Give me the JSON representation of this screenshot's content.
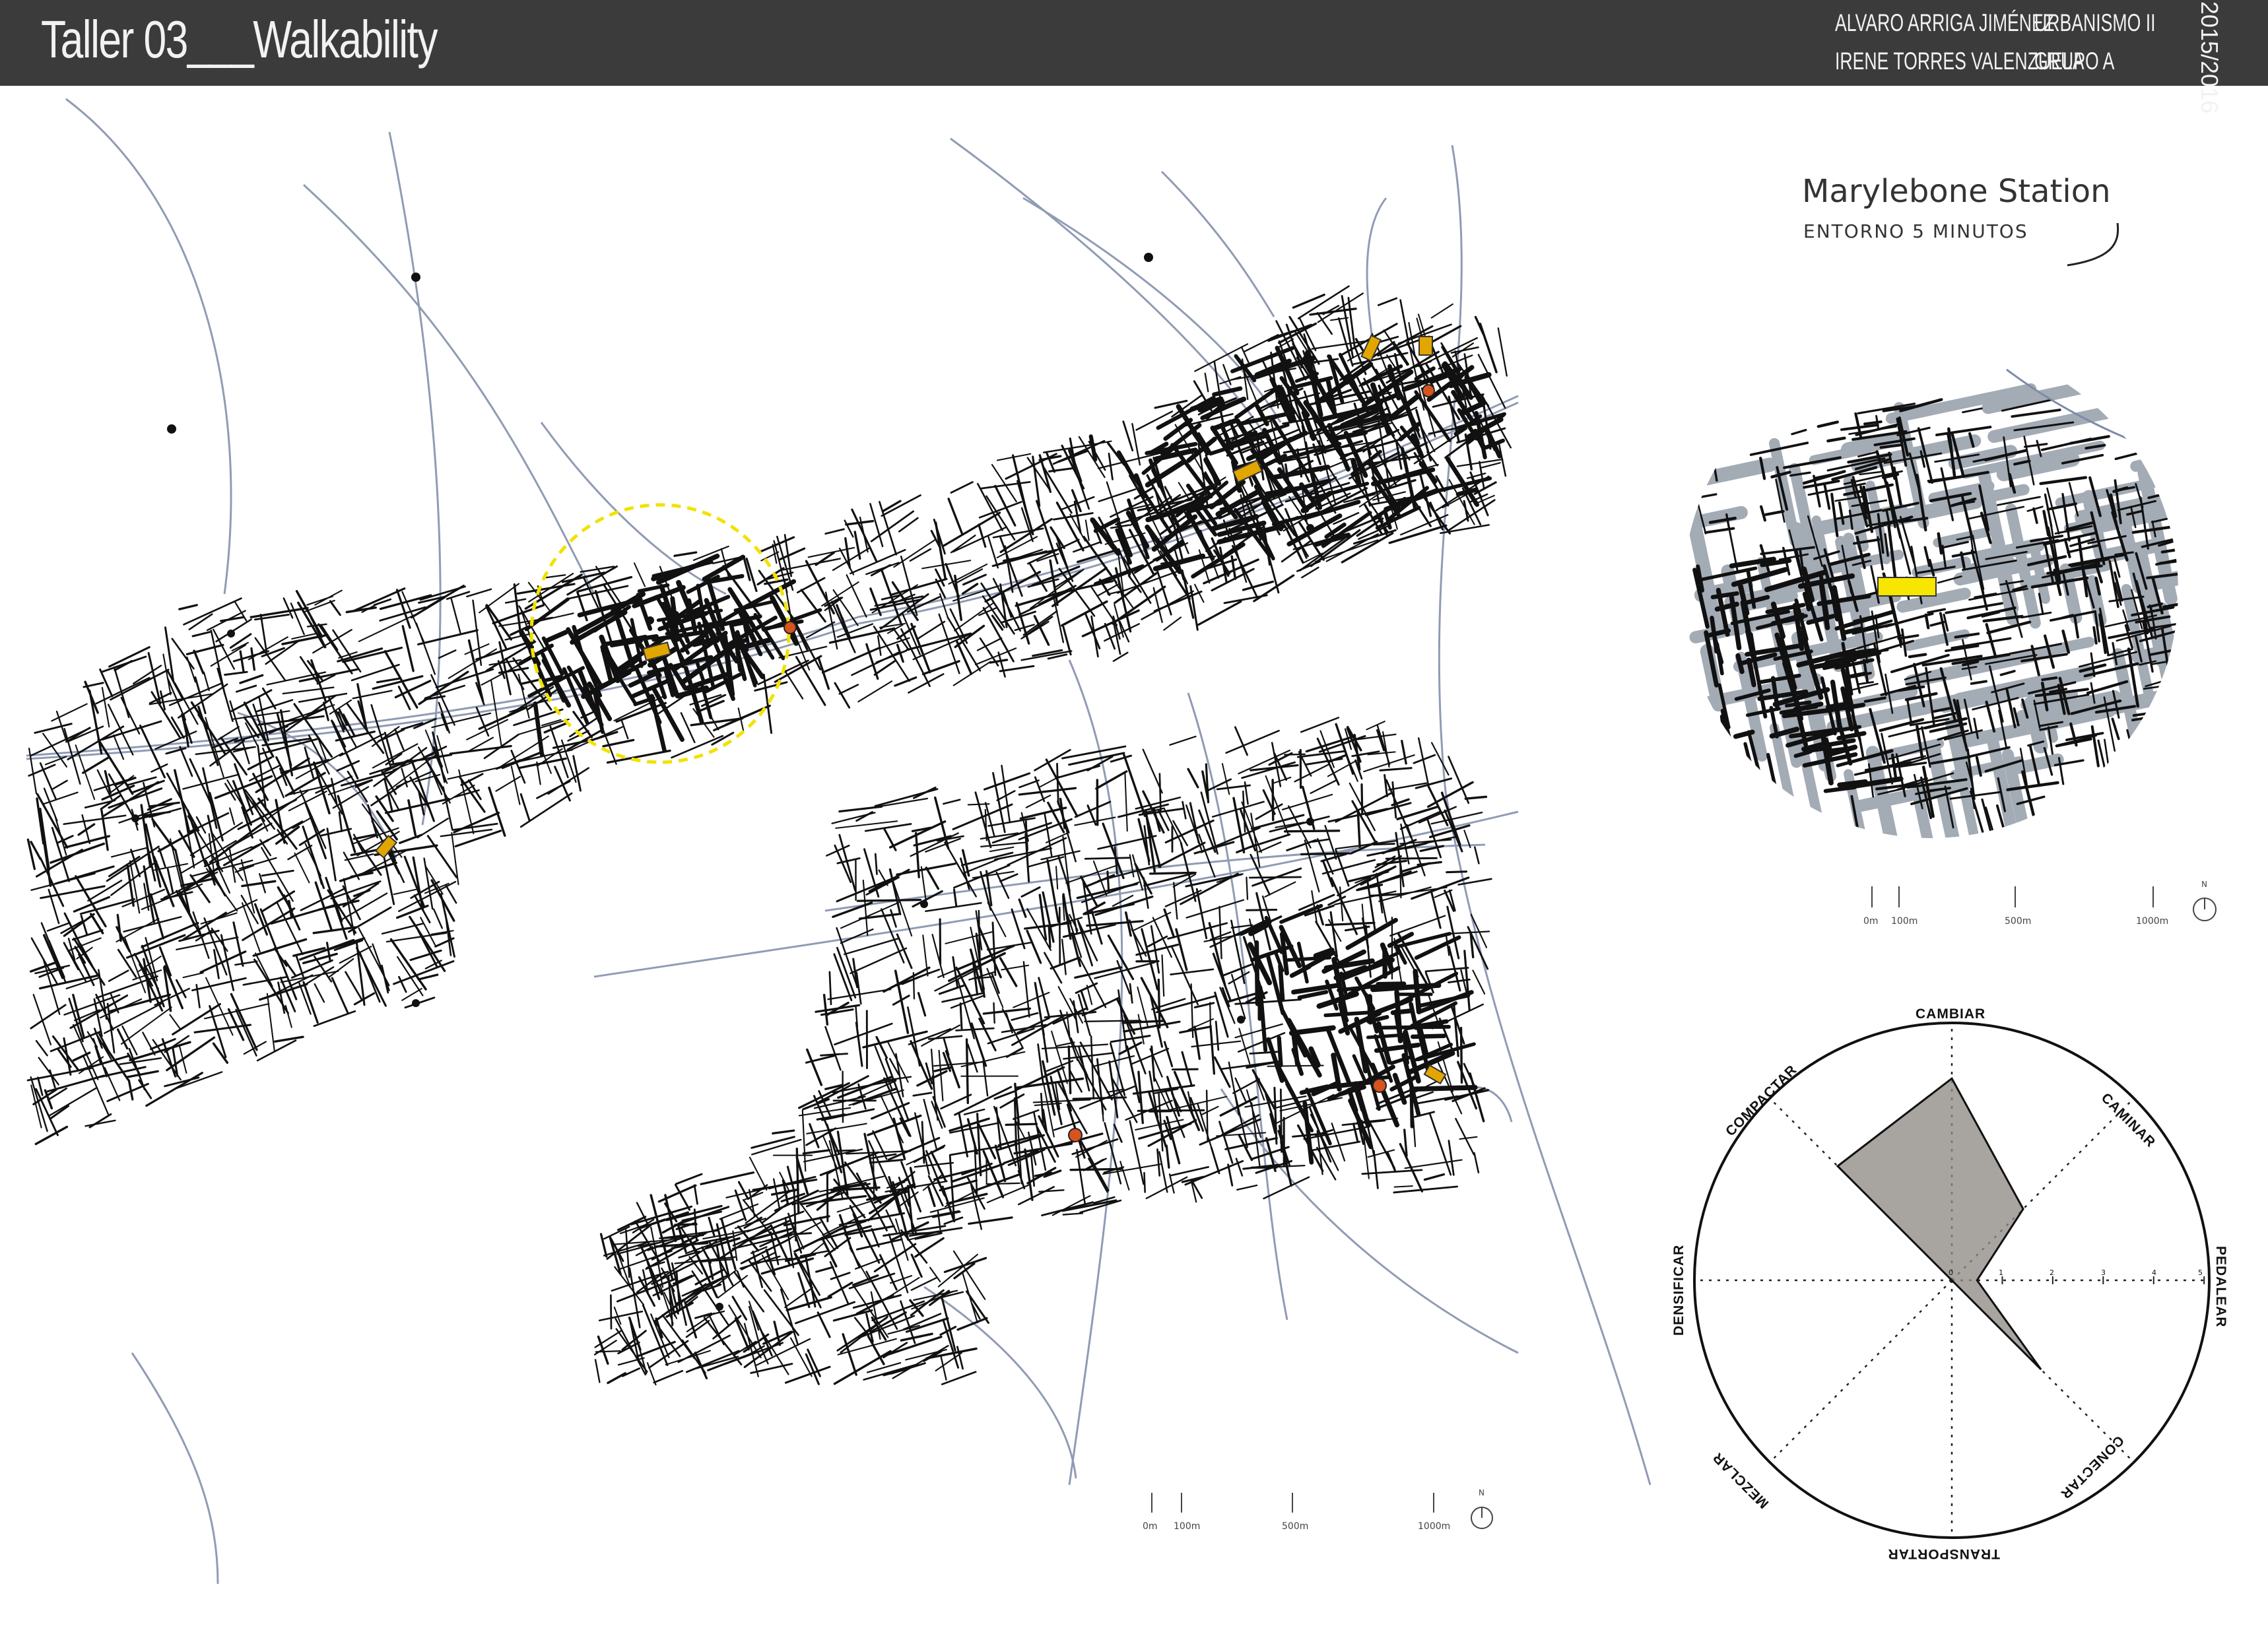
{
  "header": {
    "title": "Taller 03___Walkability",
    "author_1": "ALVARO ARRIGA JIMÉNEZ",
    "author_2": "IRENE TORRES VALENZUELA",
    "course": "URBANISMO II",
    "group": "GRUPO A",
    "year": "2015/2016"
  },
  "inset": {
    "title": "Marylebone Station",
    "subtitle": "ENTORNO 5 MINUTOS"
  },
  "main_scale": {
    "labels": [
      "0m",
      "100m",
      "500m",
      "1000m"
    ],
    "north": "N"
  },
  "inset_scale": {
    "labels": [
      "0m",
      "100m",
      "500m",
      "1000m"
    ],
    "north": "N"
  },
  "radar": {
    "axes": [
      "CAMBIAR",
      "CAMINAR",
      "PEDALEAR",
      "CONECTAR",
      "TRANSPORTAR",
      "MEZCLAR",
      "DENSIFICAR",
      "COMPACTAR"
    ],
    "scale_ticks": [
      "0",
      "1",
      "2",
      "3",
      "4",
      "5"
    ],
    "max": 5,
    "values": [
      4,
      2,
      0.5,
      2.5,
      0,
      0,
      0,
      3.2
    ]
  },
  "colors": {
    "header_bg": "#3b3b3b",
    "street": "#111111",
    "rail": "#7d8aa8",
    "highlight_circle": "#f2e200",
    "station": "#e2a600",
    "stop": "#d9531e",
    "radar_fill": "#8f8c87"
  }
}
